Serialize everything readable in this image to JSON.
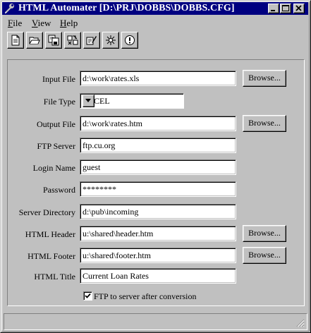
{
  "window": {
    "title": "HTML Automater [D:\\PRJ\\DOBBS\\DOBBS.CFG]",
    "title_bar_color": "#000080",
    "face_color": "#c0c0c0"
  },
  "title_buttons": [
    {
      "name": "minimize",
      "icon": "minimize-icon"
    },
    {
      "name": "maximize",
      "icon": "maximize-icon"
    },
    {
      "name": "close",
      "icon": "close-icon"
    }
  ],
  "menu": {
    "file": {
      "mnemonic": "F",
      "rest": "ile"
    },
    "view": {
      "mnemonic": "V",
      "rest": "iew"
    },
    "help": {
      "mnemonic": "H",
      "rest": "elp"
    }
  },
  "toolbar": [
    {
      "icon": "new-document-icon"
    },
    {
      "icon": "open-folder-icon"
    },
    {
      "icon": "save-as-icon"
    },
    {
      "icon": "convert-icon"
    },
    {
      "icon": "edit-settings-icon"
    },
    {
      "icon": "run-sparkle-icon"
    },
    {
      "icon": "about-info-icon"
    }
  ],
  "form": {
    "input_file": {
      "label": "Input File",
      "value": "d:\\work\\rates.xls"
    },
    "file_type": {
      "label": "File Type",
      "value": "EXCEL"
    },
    "output_file": {
      "label": "Output File",
      "value": "d:\\work\\rates.htm"
    },
    "ftp_server": {
      "label": "FTP Server",
      "value": "ftp.cu.org"
    },
    "login_name": {
      "label": "Login Name",
      "value": "guest"
    },
    "password": {
      "label": "Password",
      "value": "********"
    },
    "server_directory": {
      "label": "Server Directory",
      "value": "d:\\pub\\incoming"
    },
    "html_header": {
      "label": "HTML Header",
      "value": "u:\\shared\\header.htm"
    },
    "html_footer": {
      "label": "HTML Footer",
      "value": "u:\\shared\\footer.htm"
    },
    "html_title": {
      "label": "HTML Title",
      "value": "Current Loan Rates"
    },
    "browse_label": "Browse...",
    "ftp_after_conversion": {
      "label": "FTP to server after conversion",
      "checked": true
    }
  },
  "status": ""
}
